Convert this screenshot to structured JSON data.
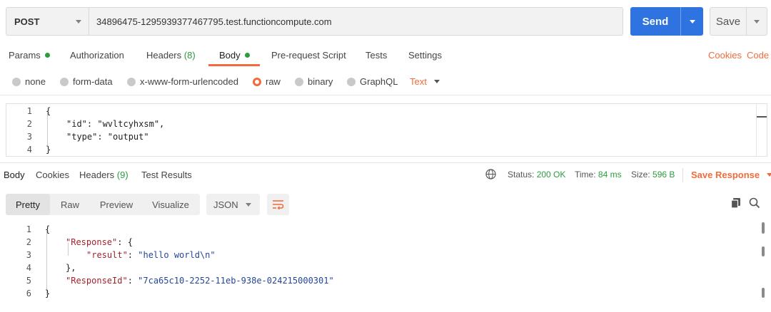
{
  "request": {
    "method": "POST",
    "url": "34896475-1295939377467795.test.functioncompute.com",
    "send_label": "Send",
    "save_label": "Save"
  },
  "request_tabs": [
    {
      "label": "Params",
      "dot": true
    },
    {
      "label": "Authorization"
    },
    {
      "label": "Headers",
      "count": "(8)"
    },
    {
      "label": "Body",
      "dot": true,
      "active": true
    },
    {
      "label": "Pre-request Script"
    },
    {
      "label": "Tests"
    },
    {
      "label": "Settings"
    }
  ],
  "request_links": {
    "cookies": "Cookies",
    "code": "Code"
  },
  "body_types": [
    {
      "label": "none"
    },
    {
      "label": "form-data"
    },
    {
      "label": "x-www-form-urlencoded"
    },
    {
      "label": "raw",
      "selected": true
    },
    {
      "label": "binary"
    },
    {
      "label": "GraphQL"
    }
  ],
  "raw_format": "Text",
  "request_body": {
    "line_numbers": [
      "1",
      "2",
      "3",
      "4"
    ],
    "lines": [
      "{",
      "\"id\": \"wvltcyhxsm\",",
      "\"type\": \"output\"",
      "}"
    ]
  },
  "response_tabs": [
    {
      "label": "Body",
      "active": true
    },
    {
      "label": "Cookies"
    },
    {
      "label": "Headers",
      "count": "(9)"
    },
    {
      "label": "Test Results"
    }
  ],
  "response_meta": {
    "status_label": "Status:",
    "status_value": "200 OK",
    "time_label": "Time:",
    "time_value": "84 ms",
    "size_label": "Size:",
    "size_value": "596 B",
    "save_response": "Save Response"
  },
  "view_modes": [
    "Pretty",
    "Raw",
    "Preview",
    "Visualize"
  ],
  "response_format": "JSON",
  "response_body": {
    "line_numbers": [
      "1",
      "2",
      "3",
      "4",
      "5",
      "6"
    ],
    "k1": "\"Response\"",
    "k2": "\"result\"",
    "v2": "\"hello world\\n\"",
    "k3": "\"ResponseId\"",
    "v3": "\"7ca65c10-2252-11eb-938e-024215000301\""
  },
  "colors": {
    "accent": "#f26b3a",
    "send": "#2f73e0",
    "success": "#2a9d3d",
    "json_key": "#a0232b",
    "json_string": "#23479a"
  },
  "icons": [
    "chevron-down-icon",
    "globe-icon",
    "wrap-lines-icon",
    "copy-icon",
    "search-icon"
  ]
}
